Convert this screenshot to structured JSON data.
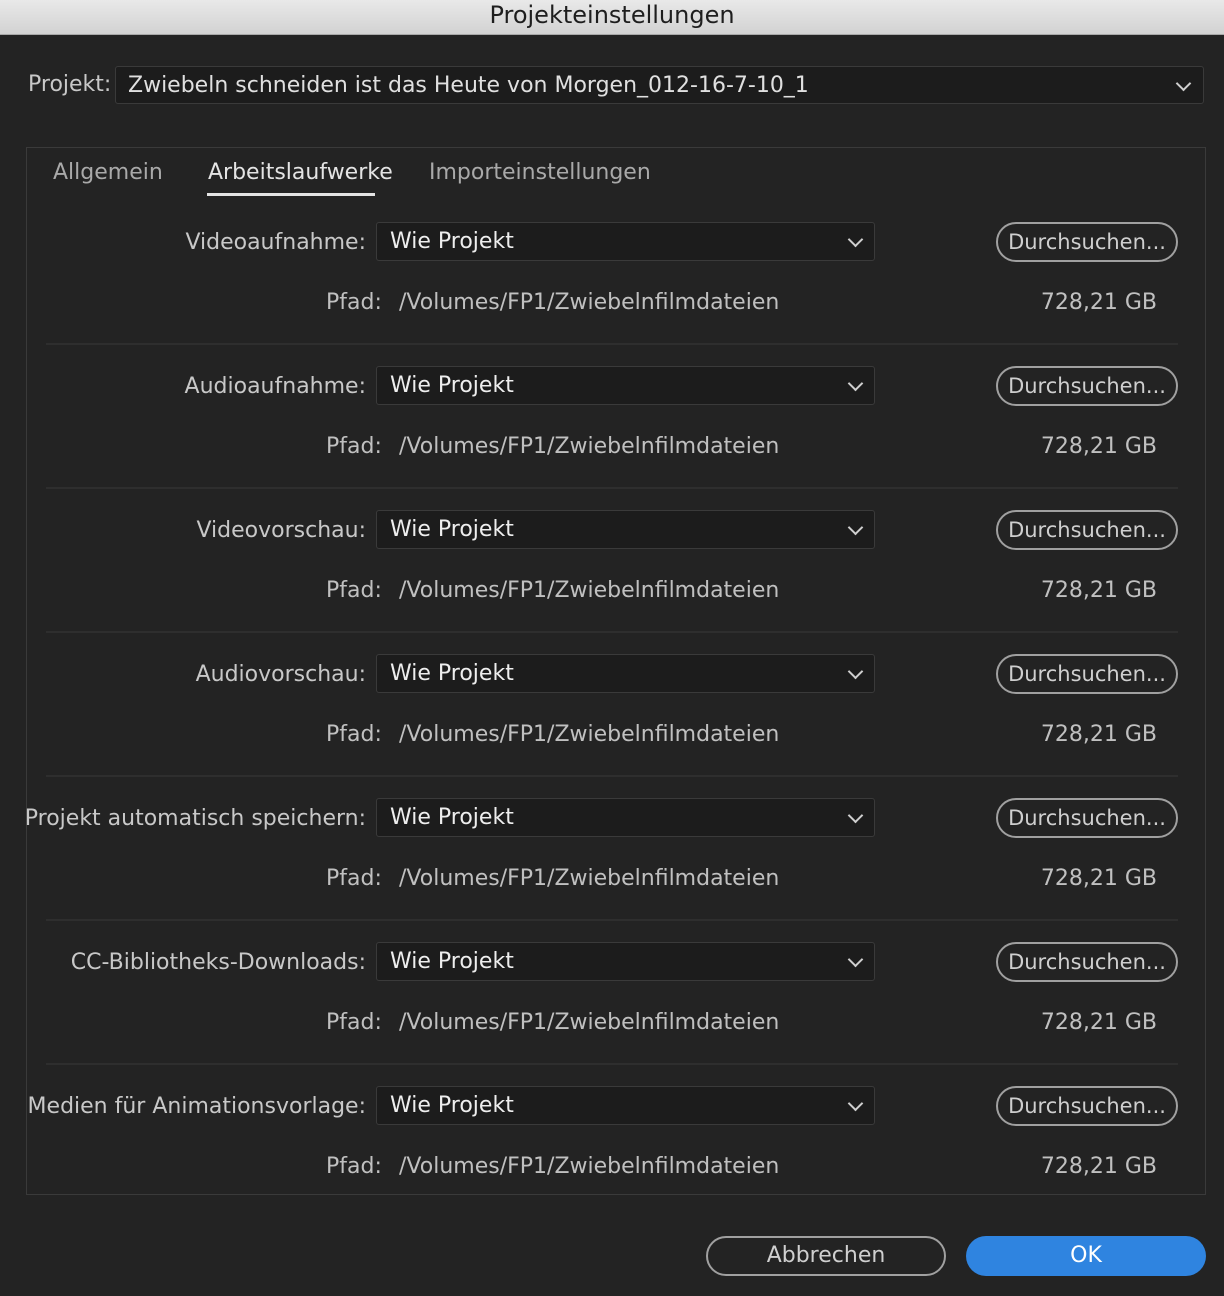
{
  "window": {
    "title": "Projekteinstellungen"
  },
  "project": {
    "label": "Projekt:",
    "value": "Zwiebeln schneiden ist das Heute von Morgen_012-16-7-10_1"
  },
  "tabs": [
    {
      "label": "Allgemein",
      "active": false
    },
    {
      "label": "Arbeitslaufwerke",
      "active": true
    },
    {
      "label": "Importeinstellungen",
      "active": false
    }
  ],
  "sections": [
    {
      "label": "Videoaufnahme:",
      "value": "Wie Projekt",
      "browse": "Durchsuchen...",
      "path_label": "Pfad:",
      "path": "/Volumes/FP1/Zwiebelnfilmdateien",
      "size": "728,21 GB"
    },
    {
      "label": "Audioaufnahme:",
      "value": "Wie Projekt",
      "browse": "Durchsuchen...",
      "path_label": "Pfad:",
      "path": "/Volumes/FP1/Zwiebelnfilmdateien",
      "size": "728,21 GB"
    },
    {
      "label": "Videovorschau:",
      "value": "Wie Projekt",
      "browse": "Durchsuchen...",
      "path_label": "Pfad:",
      "path": "/Volumes/FP1/Zwiebelnfilmdateien",
      "size": "728,21 GB"
    },
    {
      "label": "Audiovorschau:",
      "value": "Wie Projekt",
      "browse": "Durchsuchen...",
      "path_label": "Pfad:",
      "path": "/Volumes/FP1/Zwiebelnfilmdateien",
      "size": "728,21 GB"
    },
    {
      "label": "Projekt automatisch speichern:",
      "value": "Wie Projekt",
      "browse": "Durchsuchen...",
      "path_label": "Pfad:",
      "path": "/Volumes/FP1/Zwiebelnfilmdateien",
      "size": "728,21 GB"
    },
    {
      "label": "CC-Bibliotheks-Downloads:",
      "value": "Wie Projekt",
      "browse": "Durchsuchen...",
      "path_label": "Pfad:",
      "path": "/Volumes/FP1/Zwiebelnfilmdateien",
      "size": "728,21 GB"
    },
    {
      "label": "Medien für Animationsvorlage:",
      "value": "Wie Projekt",
      "browse": "Durchsuchen...",
      "path_label": "Pfad:",
      "path": "/Volumes/FP1/Zwiebelnfilmdateien",
      "size": "728,21 GB"
    }
  ],
  "footer": {
    "cancel_label": "Abbrechen",
    "ok_label": "OK"
  },
  "colors": {
    "background": "#232323",
    "accent": "#2f84e0"
  }
}
